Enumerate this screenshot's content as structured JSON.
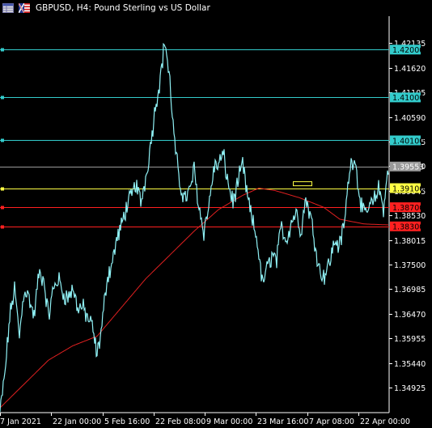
{
  "header": {
    "title": "GBPUSD, H4:  Pound Sterling vs US Dollar",
    "icon_left": "table-icon",
    "icon_right": "flag-icon"
  },
  "chart_data": {
    "type": "line",
    "symbol": "GBPUSD",
    "timeframe": "H4",
    "ylim": [
      1.344,
      1.427
    ],
    "y_ticks": [
      1.42135,
      1.4162,
      1.41105,
      1.4059,
      1.40075,
      1.3956,
      1.39045,
      1.3853,
      1.38015,
      1.375,
      1.36985,
      1.3647,
      1.35955,
      1.3544,
      1.34925
    ],
    "x_ticks": [
      "7 Jan 2021",
      "22 Jan 00:00",
      "5 Feb 16:00",
      "22 Feb 08:00",
      "9 Mar 00:00",
      "23 Mar 16:00",
      "7 Apr 08:00",
      "22 Apr 00:00"
    ],
    "price_levels": [
      {
        "value": 1.42,
        "label": "1.42000",
        "color": "#33cccc"
      },
      {
        "value": 1.41,
        "label": "1.41000",
        "color": "#33cccc"
      },
      {
        "value": 1.401,
        "label": "1.40100",
        "color": "#33cccc"
      },
      {
        "value": 1.391,
        "label": "1.39100",
        "color": "#ffff44"
      },
      {
        "value": 1.387,
        "label": "1.38700",
        "color": "#ff2020"
      },
      {
        "value": 1.383,
        "label": "1.38300",
        "color": "#ff2020"
      }
    ],
    "current_price": {
      "value": 1.39553,
      "label": "1.39553",
      "color": "#9a9a9a"
    },
    "price_anchors": [
      [
        0,
        1.344
      ],
      [
        6,
        1.352
      ],
      [
        12,
        1.364
      ],
      [
        18,
        1.37
      ],
      [
        24,
        1.36
      ],
      [
        30,
        1.37
      ],
      [
        36,
        1.368
      ],
      [
        42,
        1.364
      ],
      [
        48,
        1.373
      ],
      [
        54,
        1.372
      ],
      [
        60,
        1.364
      ],
      [
        66,
        1.37
      ],
      [
        72,
        1.372
      ],
      [
        78,
        1.369
      ],
      [
        84,
        1.368
      ],
      [
        90,
        1.37
      ],
      [
        96,
        1.366
      ],
      [
        102,
        1.366
      ],
      [
        108,
        1.364
      ],
      [
        114,
        1.362
      ],
      [
        120,
        1.356
      ],
      [
        126,
        1.362
      ],
      [
        132,
        1.372
      ],
      [
        138,
        1.375
      ],
      [
        144,
        1.38
      ],
      [
        150,
        1.383
      ],
      [
        156,
        1.387
      ],
      [
        162,
        1.389
      ],
      [
        168,
        1.392
      ],
      [
        174,
        1.388
      ],
      [
        180,
        1.393
      ],
      [
        186,
        1.4
      ],
      [
        192,
        1.408
      ],
      [
        198,
        1.414
      ],
      [
        204,
        1.422
      ],
      [
        210,
        1.413
      ],
      [
        216,
        1.4
      ],
      [
        222,
        1.392
      ],
      [
        228,
        1.389
      ],
      [
        234,
        1.39
      ],
      [
        240,
        1.395
      ],
      [
        246,
        1.387
      ],
      [
        252,
        1.382
      ],
      [
        258,
        1.387
      ],
      [
        264,
        1.395
      ],
      [
        270,
        1.396
      ],
      [
        276,
        1.398
      ],
      [
        282,
        1.392
      ],
      [
        288,
        1.388
      ],
      [
        294,
        1.392
      ],
      [
        300,
        1.396
      ],
      [
        306,
        1.389
      ],
      [
        312,
        1.384
      ],
      [
        318,
        1.38
      ],
      [
        324,
        1.371
      ],
      [
        330,
        1.374
      ],
      [
        336,
        1.377
      ],
      [
        342,
        1.376
      ],
      [
        348,
        1.383
      ],
      [
        354,
        1.38
      ],
      [
        360,
        1.384
      ],
      [
        366,
        1.386
      ],
      [
        372,
        1.382
      ],
      [
        378,
        1.389
      ],
      [
        384,
        1.385
      ],
      [
        390,
        1.379
      ],
      [
        396,
        1.373
      ],
      [
        402,
        1.373
      ],
      [
        408,
        1.376
      ],
      [
        414,
        1.38
      ],
      [
        420,
        1.379
      ],
      [
        426,
        1.384
      ],
      [
        432,
        1.395
      ],
      [
        438,
        1.398
      ],
      [
        444,
        1.39
      ],
      [
        450,
        1.385
      ],
      [
        456,
        1.387
      ],
      [
        462,
        1.388
      ],
      [
        468,
        1.391
      ],
      [
        474,
        1.387
      ],
      [
        480,
        1.395
      ]
    ],
    "ma_anchors": [
      [
        0,
        1.345
      ],
      [
        30,
        1.35
      ],
      [
        60,
        1.355
      ],
      [
        90,
        1.358
      ],
      [
        120,
        1.36
      ],
      [
        150,
        1.366
      ],
      [
        180,
        1.372
      ],
      [
        210,
        1.377
      ],
      [
        240,
        1.382
      ],
      [
        270,
        1.3865
      ],
      [
        300,
        1.3895
      ],
      [
        320,
        1.391
      ],
      [
        340,
        1.3905
      ],
      [
        370,
        1.389
      ],
      [
        400,
        1.387
      ],
      [
        420,
        1.3845
      ],
      [
        450,
        1.3835
      ],
      [
        480,
        1.3833
      ]
    ],
    "annotation": {
      "type": "rectangle",
      "price": 1.3915,
      "color": "#ffff44"
    },
    "colors": {
      "background": "#000000",
      "price_line": "#8ff0f4",
      "moving_average": "#e02020",
      "axis": "#ffffff"
    }
  }
}
